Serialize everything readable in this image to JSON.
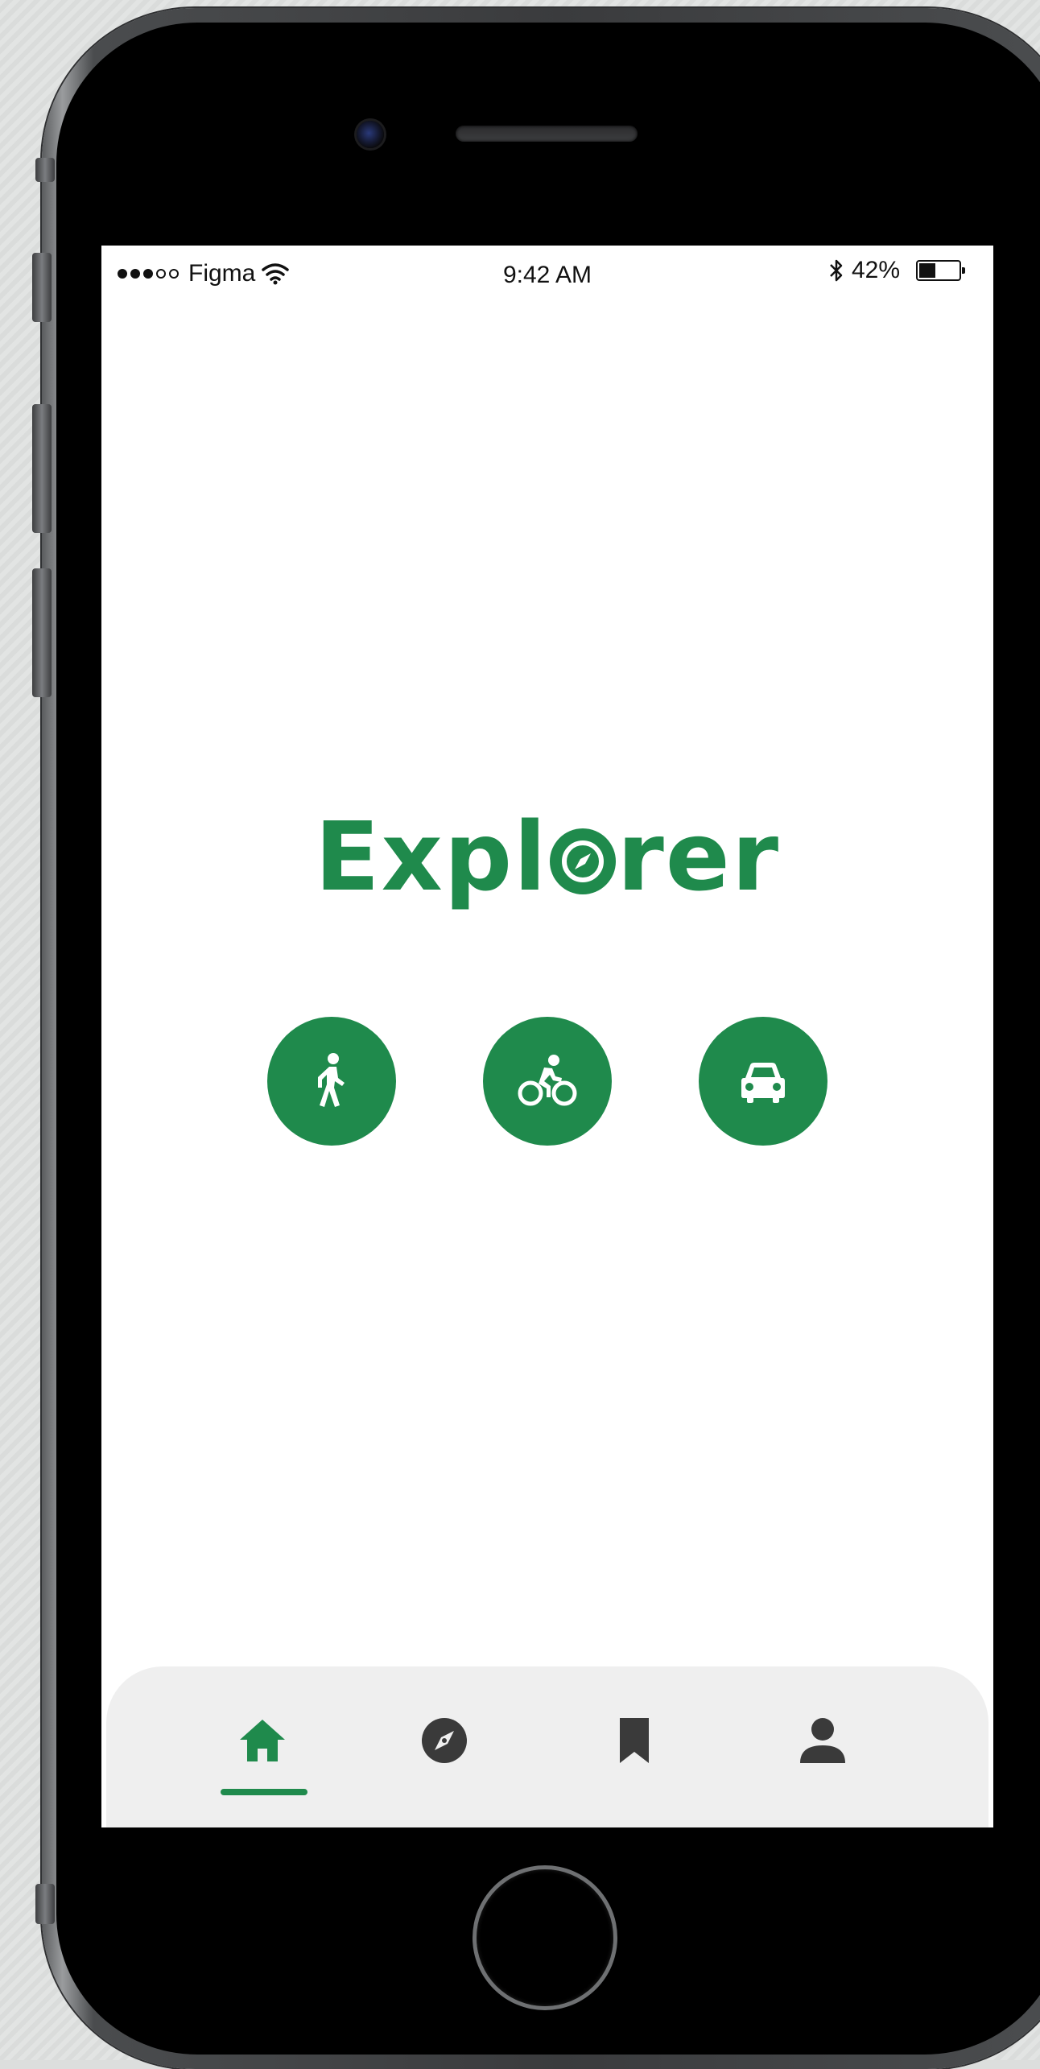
{
  "status_bar": {
    "signal_dots_filled": 3,
    "signal_dots_total": 5,
    "carrier": "Figma",
    "time": "9:42 AM",
    "battery_percent": "42%",
    "battery_level": 0.42
  },
  "app": {
    "logo_text_before": "Expl",
    "logo_text_after": "rer",
    "brand_color": "#1f8a4c"
  },
  "modes": [
    {
      "icon": "walk-icon"
    },
    {
      "icon": "bike-icon"
    },
    {
      "icon": "car-icon"
    }
  ],
  "tab_bar": {
    "tabs": [
      {
        "icon": "home-icon",
        "active": true
      },
      {
        "icon": "compass-icon",
        "active": false
      },
      {
        "icon": "bookmark-icon",
        "active": false
      },
      {
        "icon": "person-icon",
        "active": false
      }
    ],
    "active_color": "#1f8a4c",
    "inactive_color": "#3a3a3a"
  }
}
